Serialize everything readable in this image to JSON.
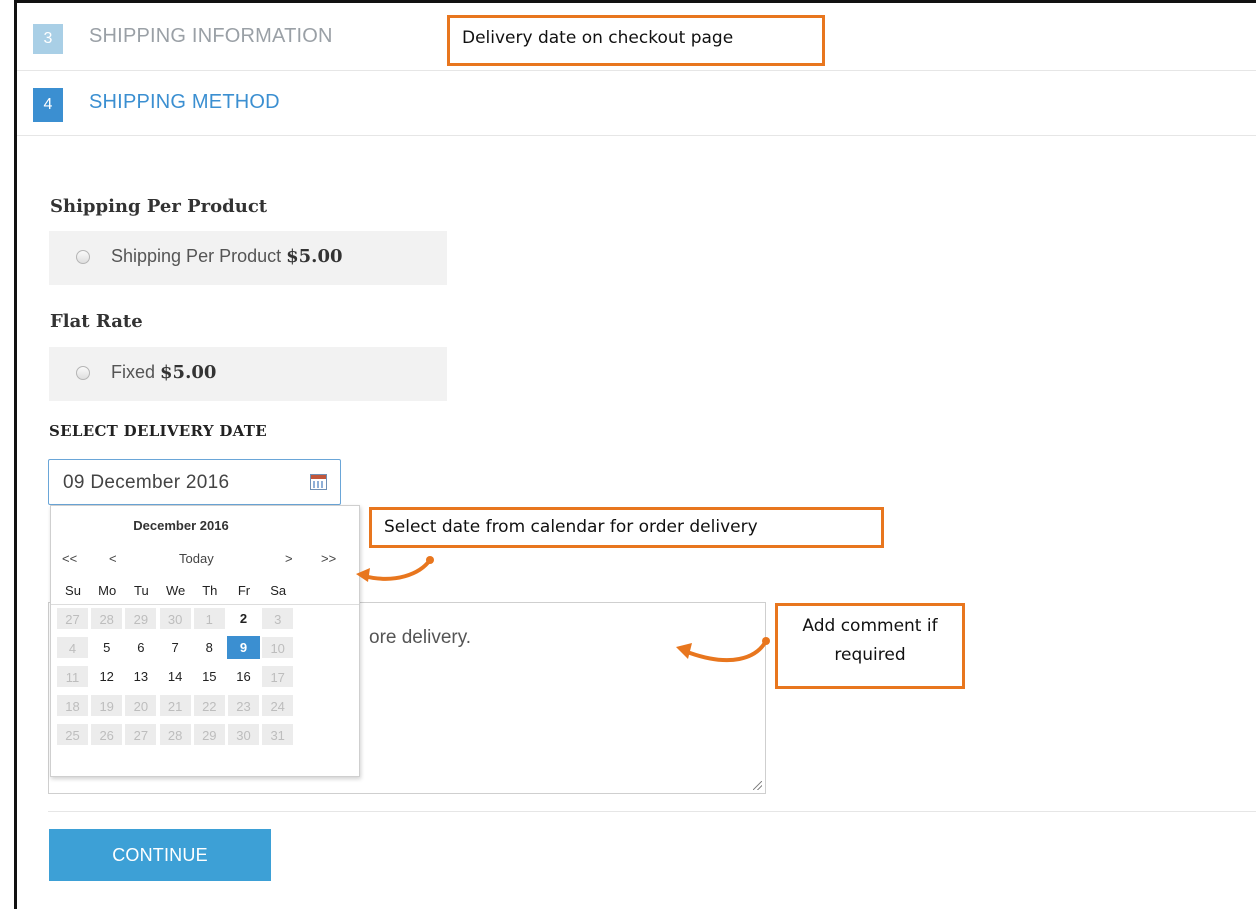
{
  "steps": [
    {
      "number": "3",
      "label": "SHIPPING INFORMATION"
    },
    {
      "number": "4",
      "label": "SHIPPING METHOD"
    }
  ],
  "annotations": {
    "checkout": "Delivery date on checkout page",
    "calendar": "Select date from calendar for order delivery",
    "comment_line1": "Add comment if",
    "comment_line2": "required"
  },
  "shipping": {
    "per_product_title": "Shipping Per Product",
    "per_product_option": "Shipping Per Product",
    "per_product_price": "$5.00",
    "flat_rate_title": "Flat Rate",
    "flat_rate_option": "Fixed",
    "flat_rate_price": "$5.00"
  },
  "delivery": {
    "title": "SELECT DELIVERY DATE",
    "date_value": "09 December 2016",
    "comment_visible": "ore delivery."
  },
  "calendar": {
    "month_title": "December 2016",
    "nav": {
      "prev_year": "<<",
      "prev_month": "<",
      "today": "Today",
      "next_month": ">",
      "next_year": ">>"
    },
    "weekdays": [
      "Su",
      "Mo",
      "Tu",
      "We",
      "Th",
      "Fr",
      "Sa"
    ],
    "weeks": [
      [
        {
          "d": "27",
          "s": "off"
        },
        {
          "d": "28",
          "s": "off"
        },
        {
          "d": "29",
          "s": "off"
        },
        {
          "d": "30",
          "s": "off"
        },
        {
          "d": "1",
          "s": "off"
        },
        {
          "d": "2",
          "s": "bold"
        },
        {
          "d": "3",
          "s": "off"
        }
      ],
      [
        {
          "d": "4",
          "s": "off"
        },
        {
          "d": "5",
          "s": "on"
        },
        {
          "d": "6",
          "s": "on"
        },
        {
          "d": "7",
          "s": "on"
        },
        {
          "d": "8",
          "s": "on"
        },
        {
          "d": "9",
          "s": "sel"
        },
        {
          "d": "10",
          "s": "off"
        }
      ],
      [
        {
          "d": "11",
          "s": "off"
        },
        {
          "d": "12",
          "s": "on"
        },
        {
          "d": "13",
          "s": "on"
        },
        {
          "d": "14",
          "s": "on"
        },
        {
          "d": "15",
          "s": "on"
        },
        {
          "d": "16",
          "s": "on"
        },
        {
          "d": "17",
          "s": "off"
        }
      ],
      [
        {
          "d": "18",
          "s": "off"
        },
        {
          "d": "19",
          "s": "off"
        },
        {
          "d": "20",
          "s": "off"
        },
        {
          "d": "21",
          "s": "off"
        },
        {
          "d": "22",
          "s": "off"
        },
        {
          "d": "23",
          "s": "off"
        },
        {
          "d": "24",
          "s": "off"
        }
      ],
      [
        {
          "d": "25",
          "s": "off"
        },
        {
          "d": "26",
          "s": "off"
        },
        {
          "d": "27",
          "s": "off"
        },
        {
          "d": "28",
          "s": "off"
        },
        {
          "d": "29",
          "s": "off"
        },
        {
          "d": "30",
          "s": "off"
        },
        {
          "d": "31",
          "s": "off"
        }
      ]
    ]
  },
  "buttons": {
    "continue": "CONTINUE"
  },
  "colors": {
    "accent": "#3b8fd1",
    "annotation": "#e8761e",
    "button": "#3da0d6"
  }
}
